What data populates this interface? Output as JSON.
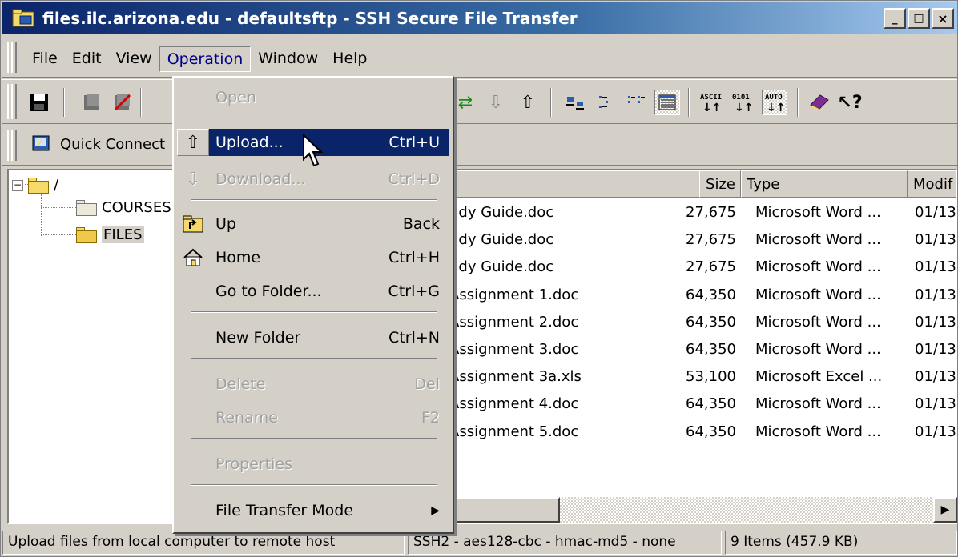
{
  "window": {
    "title": "files.ilc.arizona.edu - defaultsftp - SSH Secure File Transfer",
    "minimize": "_",
    "maximize": "□",
    "close": "×"
  },
  "menubar": {
    "items": [
      {
        "label": "File"
      },
      {
        "label": "Edit"
      },
      {
        "label": "View"
      },
      {
        "label": "Operation",
        "active": true
      },
      {
        "label": "Window"
      },
      {
        "label": "Help"
      }
    ]
  },
  "quickbar": {
    "quick_connect": "Quick Connect"
  },
  "tree": {
    "root": "/",
    "items": [
      "COURSES",
      "FILES"
    ],
    "expander": "−"
  },
  "file_list": {
    "columns": {
      "size": "Size",
      "type": "Type",
      "modified": "Modif"
    },
    "rows": [
      {
        "name": "udy Guide.doc",
        "size": "27,675",
        "type": "Microsoft Word ...",
        "modified": "01/13"
      },
      {
        "name": "udy Guide.doc",
        "size": "27,675",
        "type": "Microsoft Word ...",
        "modified": "01/13"
      },
      {
        "name": "udy Guide.doc",
        "size": "27,675",
        "type": "Microsoft Word ...",
        "modified": "01/13"
      },
      {
        "name": "Assignment 1.doc",
        "size": "64,350",
        "type": "Microsoft Word ...",
        "modified": "01/13"
      },
      {
        "name": "Assignment 2.doc",
        "size": "64,350",
        "type": "Microsoft Word ...",
        "modified": "01/13"
      },
      {
        "name": "Assignment 3.doc",
        "size": "64,350",
        "type": "Microsoft Word ...",
        "modified": "01/13"
      },
      {
        "name": "Assignment 3a.xls",
        "size": "53,100",
        "type": "Microsoft Excel ...",
        "modified": "01/13"
      },
      {
        "name": "Assignment 4.doc",
        "size": "64,350",
        "type": "Microsoft Word ...",
        "modified": "01/13"
      },
      {
        "name": "Assignment 5.doc",
        "size": "64,350",
        "type": "Microsoft Word ...",
        "modified": "01/13"
      }
    ]
  },
  "operation_menu": {
    "open": {
      "label": "Open",
      "shortcut": ""
    },
    "upload": {
      "label": "Upload...",
      "shortcut": "Ctrl+U"
    },
    "download": {
      "label": "Download...",
      "shortcut": "Ctrl+D"
    },
    "up": {
      "label": "Up",
      "shortcut": "Back"
    },
    "home": {
      "label": "Home",
      "shortcut": "Ctrl+H"
    },
    "goto": {
      "label": "Go to Folder...",
      "shortcut": "Ctrl+G"
    },
    "new_folder": {
      "label": "New Folder",
      "shortcut": "Ctrl+N"
    },
    "delete": {
      "label": "Delete",
      "shortcut": "Del"
    },
    "rename": {
      "label": "Rename",
      "shortcut": "F2"
    },
    "properties": {
      "label": "Properties"
    },
    "transfer_mode": {
      "label": "File Transfer Mode",
      "arrow": "▶"
    }
  },
  "status": {
    "message": "Upload files from local computer to remote host",
    "connection": "SSH2 - aes128-cbc - hmac-md5 - none",
    "items": "9 Items (457.9 KB)"
  },
  "colors": {
    "title_bar": "#0a246a",
    "menu_highlight": "#0a246a",
    "face": "#d4d0c8"
  },
  "icons": [
    "app-icon",
    "save-icon",
    "disconnect-icon",
    "stop-icon",
    "download-arrow-icon",
    "upload-arrow-icon",
    "refresh-icon",
    "large-icons-icon",
    "small-icons-icon",
    "list-icon",
    "details-icon",
    "ascii-icon",
    "binary-icon",
    "auto-icon",
    "help-book-icon",
    "whats-this-icon",
    "quick-connect-icon",
    "cursor-icon"
  ]
}
